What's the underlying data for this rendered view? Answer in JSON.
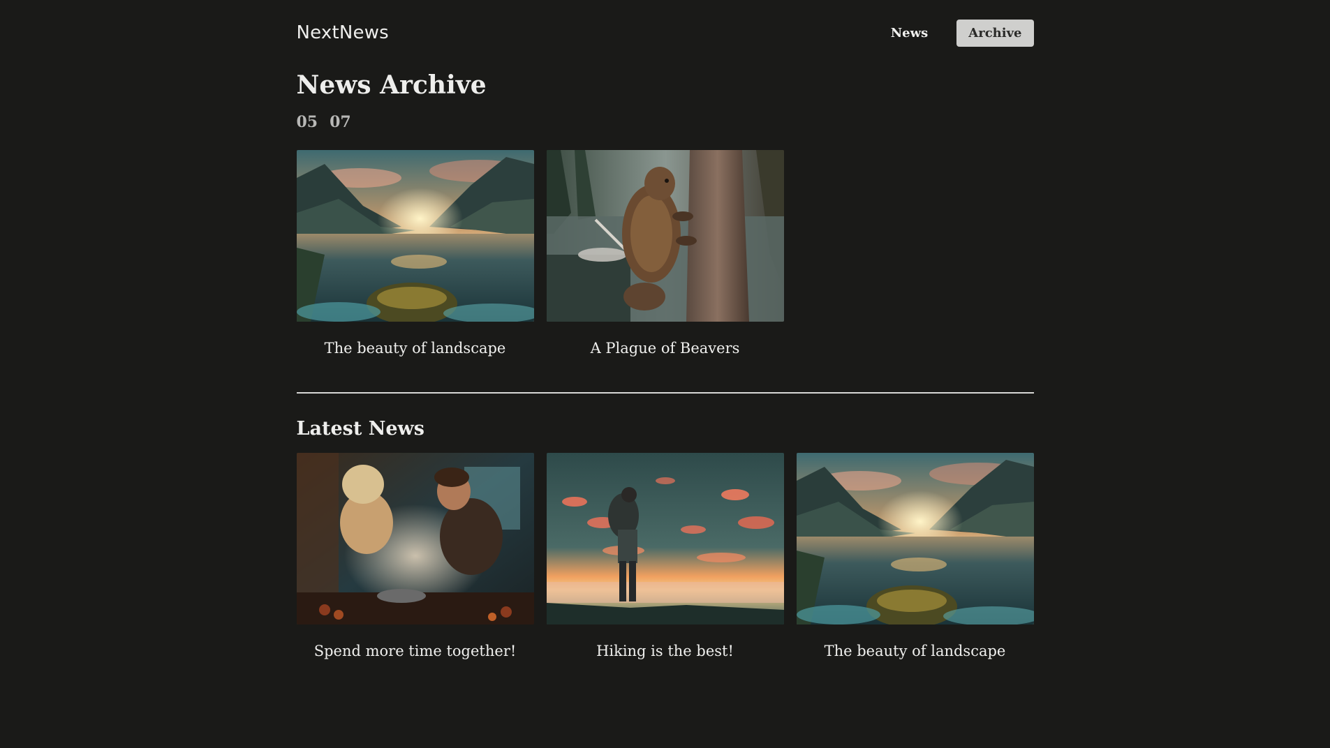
{
  "header": {
    "logo": "NextNews",
    "nav": [
      {
        "label": "News",
        "active": false
      },
      {
        "label": "Archive",
        "active": true
      }
    ]
  },
  "archive": {
    "title": "News Archive",
    "years": [
      "05",
      "07"
    ],
    "items": [
      {
        "title": "The beauty of landscape",
        "image": "mountain lake landscape at sunset"
      },
      {
        "title": "A Plague of Beavers",
        "image": "beaver climbing a tree by a forest lake"
      }
    ]
  },
  "latest": {
    "title": "Latest News",
    "items": [
      {
        "title": "Spend more time together!",
        "image": "couple cooking together in a kitchen"
      },
      {
        "title": "Hiking is the best!",
        "image": "hiker watching sunset above clouds"
      },
      {
        "title": "The beauty of landscape",
        "image": "mountain lake landscape at sunset"
      }
    ]
  },
  "colors": {
    "background": "#1a1a18",
    "text": "#eeeeec",
    "active_nav_bg": "#cfcfcd"
  }
}
